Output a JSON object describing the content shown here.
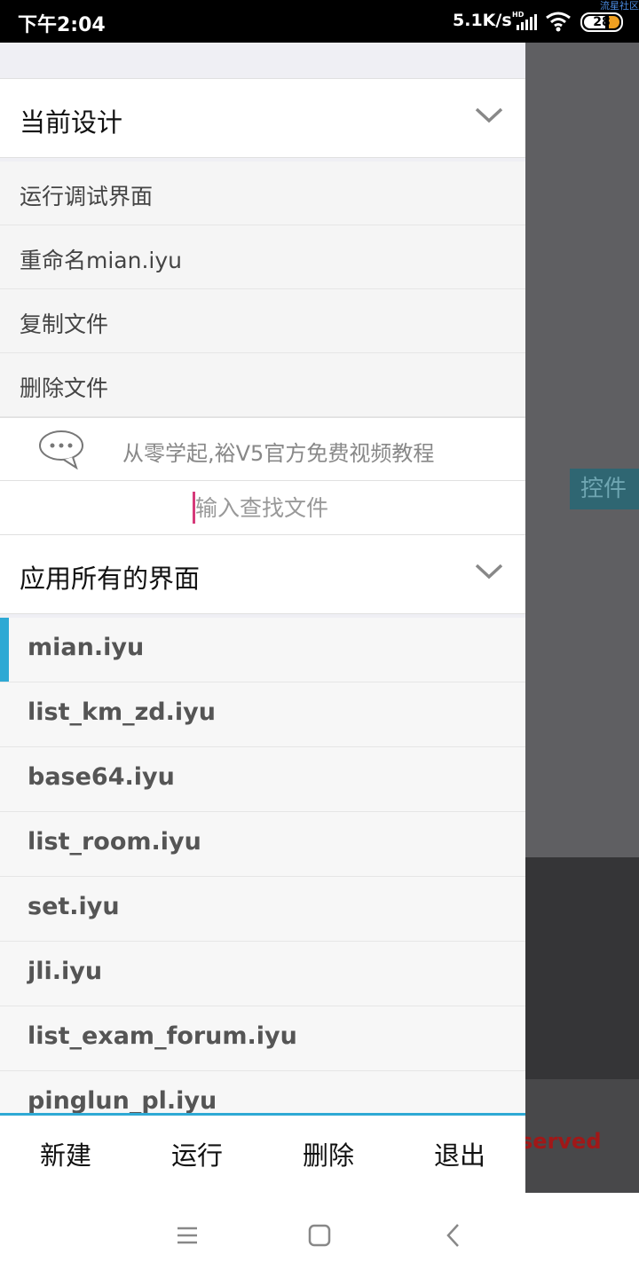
{
  "status_bar": {
    "time": "下午2:04",
    "net_speed": "5.1K/s",
    "hd": "HD",
    "battery": "28",
    "watermark": "流星社区"
  },
  "background_app": {
    "control_label": "控件",
    "reserved_text": "served"
  },
  "drawer": {
    "current_design": {
      "title": "当前设计",
      "items": [
        {
          "label": "运行调试界面"
        },
        {
          "label": "重命名mian.iyu"
        },
        {
          "label": "复制文件"
        },
        {
          "label": "删除文件"
        }
      ]
    },
    "promo": {
      "text": "从零学起,裕V5官方免费视频教程"
    },
    "search": {
      "placeholder": "输入查找文件"
    },
    "all_screens": {
      "title": "应用所有的界面",
      "files": [
        {
          "label": "mian.iyu",
          "active": true
        },
        {
          "label": "list_km_zd.iyu"
        },
        {
          "label": "base64.iyu"
        },
        {
          "label": "list_room.iyu"
        },
        {
          "label": "set.iyu"
        },
        {
          "label": "jli.iyu"
        },
        {
          "label": "list_exam_forum.iyu"
        },
        {
          "label": "pinglun_pl.iyu"
        }
      ]
    },
    "bottom_bar": {
      "new_label": "新建",
      "run_label": "运行",
      "delete_label": "删除",
      "exit_label": "退出"
    }
  },
  "colors": {
    "accent": "#2ea9d4",
    "caret": "#d63a7a"
  }
}
